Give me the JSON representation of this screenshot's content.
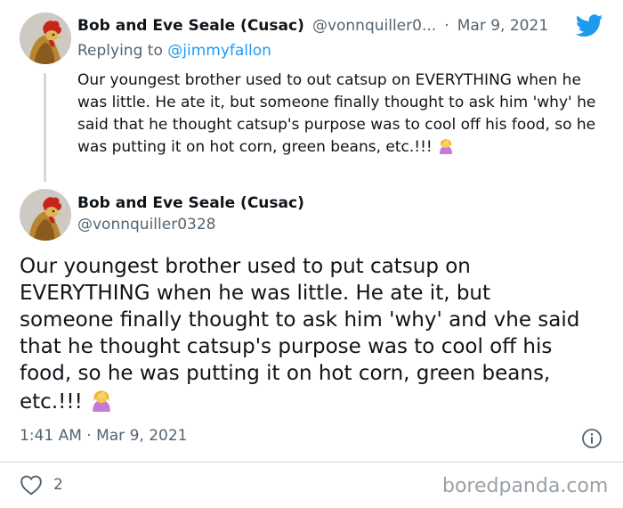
{
  "reply_tweet": {
    "author_name": "Bob and Eve Seale (Cusac)",
    "handle": "@vonnquiller0...",
    "separator": "·",
    "date": "Mar 9, 2021",
    "replying_prefix": "Replying to ",
    "replying_handle": "@jimmyfallon",
    "text": "Our youngest brother used to out catsup on EVERYTHING when he was little. He ate it, but someone finally thought to ask him 'why' he said that he thought catsup's purpose was to cool off his food, so he was putting it on hot corn, green beans, etc.!!!",
    "emoji": "woman-facepalming-icon"
  },
  "main_tweet": {
    "author_name": "Bob and Eve Seale (Cusac)",
    "handle": "@vonnquiller0328",
    "text": "Our youngest brother used to put catsup on EVERYTHING when he was little. He ate it, but someone finally thought to ask him 'why' and vhe said that he thought catsup's purpose was to cool off his food, so he was putting it on hot corn, green beans, etc.!!!",
    "emoji": "woman-facepalming-icon",
    "timestamp": "1:41 AM · Mar 9, 2021",
    "like_count": "2"
  },
  "watermark": "boredpanda.com",
  "colors": {
    "twitter_blue": "#1d9bf0",
    "muted_text": "#536471",
    "divider": "#cfd9de"
  }
}
